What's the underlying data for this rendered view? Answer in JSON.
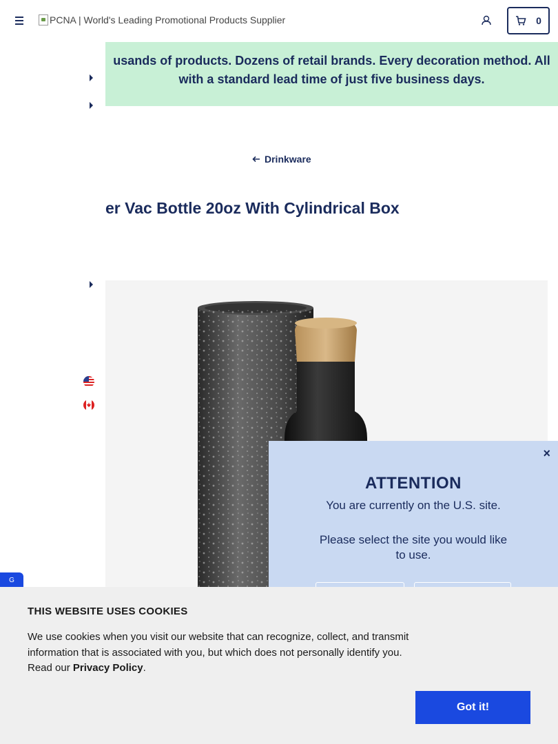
{
  "header": {
    "logo_alt": "PCNA | World's Leading Promotional Products Supplier",
    "cart_count": "0"
  },
  "promo": {
    "line1": "usands of products. Dozens of retail brands. Every decoration method. All",
    "line2": "with a standard lead time of just five business days."
  },
  "breadcrumb": {
    "label": "Drinkware"
  },
  "product": {
    "title": "er Vac Bottle 20oz With Cylindrical Box"
  },
  "side_tab": {
    "label": "G"
  },
  "modal": {
    "close": "×",
    "heading": "ATTENTION",
    "line1": "You are currently on the U.S. site.",
    "line2": "Please select the site you would like to use."
  },
  "cookie": {
    "heading": "THIS WEBSITE USES COOKIES",
    "text_before": "We use cookies when you visit our website that can recognize, collect, and transmit information that is associated with you, but which does not personally identify you. Read our ",
    "link": "Privacy Policy",
    "text_after": ".",
    "button": "Got it!"
  },
  "colors": {
    "navy": "#1a2b5c",
    "promo_bg": "#c8f0d6",
    "modal_bg": "#c9d9f2",
    "accent_blue": "#1a49e0",
    "cookie_bg": "#efefef"
  }
}
